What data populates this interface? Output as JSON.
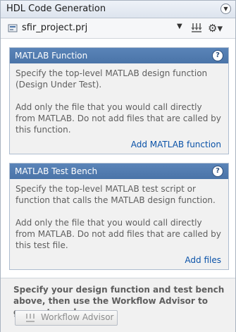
{
  "titlebar": {
    "title": "HDL Code Generation",
    "menu_glyph": "▼"
  },
  "project": {
    "file_name": "sfir_project.prj",
    "dropdown_glyph": "▼",
    "gear_glyph": "⚙▾",
    "icons": [
      "project-file-icon",
      "dropdown-arrow-icon",
      "generate-icon",
      "gear-icon"
    ]
  },
  "matlab_function": {
    "title": "MATLAB Function",
    "help": "?",
    "desc1": "Specify the top-level MATLAB design function (Design Under Test).",
    "desc2": "Add only the file that you would call directly from MATLAB. Do not add files that are called by this function.",
    "link": "Add MATLAB function"
  },
  "test_bench": {
    "title": "MATLAB Test Bench",
    "help": "?",
    "desc1": "Specify the top-level MATLAB test script or function that calls the MATLAB design function.",
    "desc2": "Add only the file that you would call directly from MATLAB. Do not add files that are called by this test file.",
    "link": "Add files"
  },
  "footer": {
    "instructions": "Specify your design function and test bench above, then use the Workflow Advisor to generate code.",
    "button_label": "Workflow Advisor"
  },
  "colors": {
    "panel_header": "#4a74a8",
    "link": "#0a52a8",
    "panel_background": "#f1f1f1"
  }
}
